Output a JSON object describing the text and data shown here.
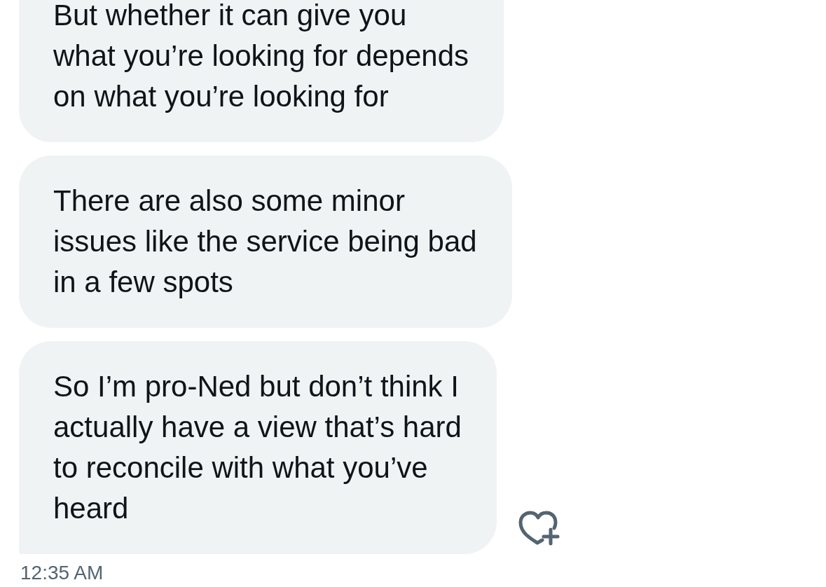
{
  "messages": [
    {
      "text": "But whether it can give you\nwhat you’re looking for depends\non what you’re looking for",
      "cut_top": true,
      "last_in_group": false
    },
    {
      "text": "There are also some minor\nissues like the service being bad\nin a few spots",
      "cut_top": false,
      "last_in_group": false
    },
    {
      "text": "So I’m pro-Ned but don’t think I\nactually have a view that’s hard\nto reconcile with what you’ve\nheard",
      "cut_top": false,
      "last_in_group": true
    }
  ],
  "timestamp": "12:35 AM"
}
